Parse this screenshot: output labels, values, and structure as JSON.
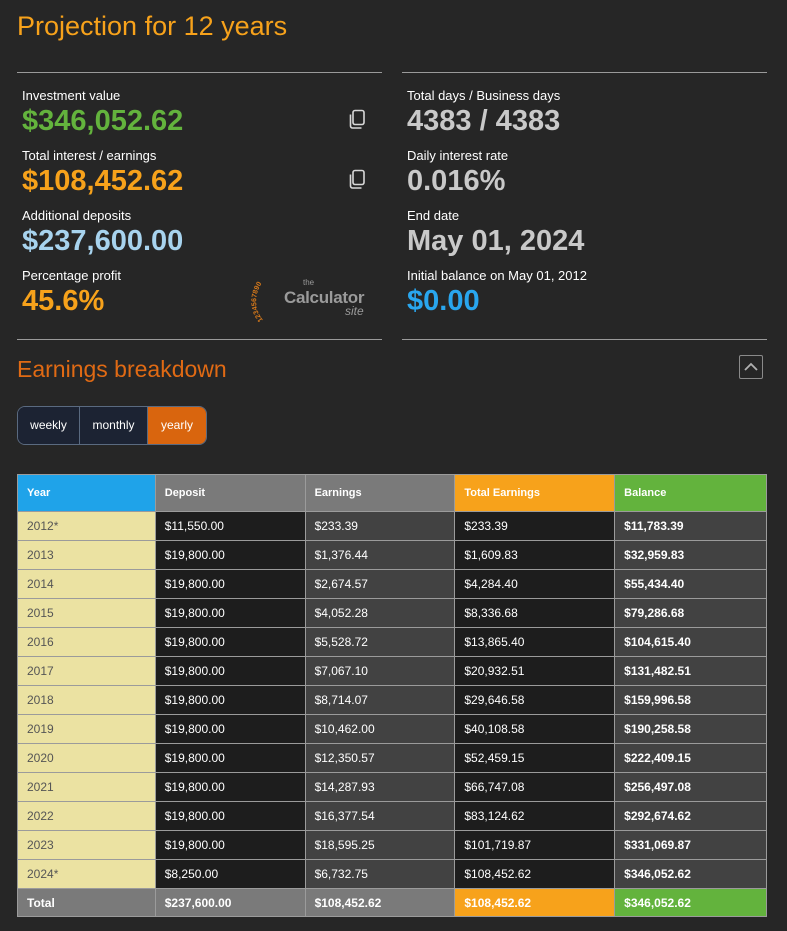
{
  "title": "Projection for 12 years",
  "summary": {
    "left": [
      {
        "label": "Investment value",
        "value": "$346,052.62",
        "color": "#63b33d"
      },
      {
        "label": "Total interest / earnings",
        "value": "$108,452.62",
        "color": "#f7a21b"
      },
      {
        "label": "Additional deposits",
        "value": "$237,600.00",
        "color": "#a7d3ee"
      },
      {
        "label": "Percentage profit",
        "value": "45.6%",
        "color": "#f7a21b"
      }
    ],
    "right": [
      {
        "label": "Total days / Business days",
        "value": "4383 / 4383",
        "color": "#c9c9c9"
      },
      {
        "label": "Daily interest rate",
        "value": "0.016%",
        "color": "#c9c9c9"
      },
      {
        "label": "End date",
        "value": "May 01, 2024",
        "color": "#c9c9c9"
      },
      {
        "label": "Initial balance on May 01, 2012",
        "value": "$0.00",
        "color": "#29a6ee"
      }
    ]
  },
  "logo": {
    "small": "the",
    "main": "Calculator",
    "sub": "site",
    "digits": "1234567890"
  },
  "breakdown": {
    "title": "Earnings breakdown",
    "tabs": [
      {
        "label": "weekly",
        "active": false
      },
      {
        "label": "monthly",
        "active": false
      },
      {
        "label": "yearly",
        "active": true
      }
    ],
    "columns": [
      "Year",
      "Deposit",
      "Earnings",
      "Total Earnings",
      "Balance"
    ],
    "rows": [
      [
        "2012*",
        "$11,550.00",
        "$233.39",
        "$233.39",
        "$11,783.39"
      ],
      [
        "2013",
        "$19,800.00",
        "$1,376.44",
        "$1,609.83",
        "$32,959.83"
      ],
      [
        "2014",
        "$19,800.00",
        "$2,674.57",
        "$4,284.40",
        "$55,434.40"
      ],
      [
        "2015",
        "$19,800.00",
        "$4,052.28",
        "$8,336.68",
        "$79,286.68"
      ],
      [
        "2016",
        "$19,800.00",
        "$5,528.72",
        "$13,865.40",
        "$104,615.40"
      ],
      [
        "2017",
        "$19,800.00",
        "$7,067.10",
        "$20,932.51",
        "$131,482.51"
      ],
      [
        "2018",
        "$19,800.00",
        "$8,714.07",
        "$29,646.58",
        "$159,996.58"
      ],
      [
        "2019",
        "$19,800.00",
        "$10,462.00",
        "$40,108.58",
        "$190,258.58"
      ],
      [
        "2020",
        "$19,800.00",
        "$12,350.57",
        "$52,459.15",
        "$222,409.15"
      ],
      [
        "2021",
        "$19,800.00",
        "$14,287.93",
        "$66,747.08",
        "$256,497.08"
      ],
      [
        "2022",
        "$19,800.00",
        "$16,377.54",
        "$83,124.62",
        "$292,674.62"
      ],
      [
        "2023",
        "$19,800.00",
        "$18,595.25",
        "$101,719.87",
        "$331,069.87"
      ],
      [
        "2024*",
        "$8,250.00",
        "$6,732.75",
        "$108,452.62",
        "$346,052.62"
      ]
    ],
    "total": [
      "Total",
      "$237,600.00",
      "$108,452.62",
      "$108,452.62",
      "$346,052.62"
    ]
  }
}
